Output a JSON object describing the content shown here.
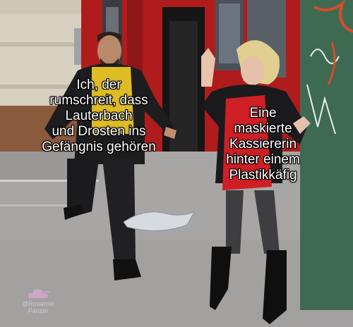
{
  "meme": {
    "left_caption": [
      "Ich, der",
      "rumschreit, dass",
      "Lauterbach",
      "und Drosten ins",
      "Gefängnis gehören"
    ],
    "right_caption": [
      "Eine",
      "maskierte",
      "Kassiererin",
      "hinter einem",
      "Plastikkäfig"
    ],
    "watermark": [
      "@Rosarote",
      "Panzer"
    ],
    "colors": {
      "storefront_red": "#b01c1c",
      "sidewalk": "#a8a6a4",
      "left_shirt": "#e0bc24",
      "right_dress": "#cf1f25",
      "caption_text": "#ffffff",
      "caption_outline": "#000000"
    }
  }
}
